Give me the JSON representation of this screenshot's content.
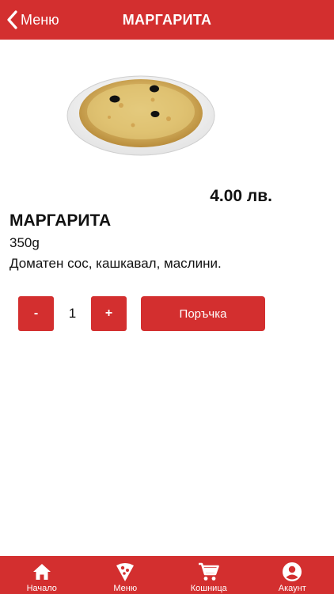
{
  "header": {
    "back_label": "Меню",
    "title": "МАРГАРИТА"
  },
  "product": {
    "price": "4.00 лв.",
    "name": "МАРГАРИТА",
    "weight": "350g",
    "description": "Доматен сос, кашкавал, маслини."
  },
  "order": {
    "minus_label": "-",
    "quantity": "1",
    "plus_label": "+",
    "order_label": "Поръчка"
  },
  "tabbar": {
    "items": [
      {
        "label": "Начало",
        "icon": "home-icon"
      },
      {
        "label": "Меню",
        "icon": "pizza-slice-icon"
      },
      {
        "label": "Кошница",
        "icon": "cart-icon"
      },
      {
        "label": "Акаунт",
        "icon": "account-icon"
      }
    ]
  },
  "colors": {
    "accent": "#d32f2f",
    "text": "#111111",
    "background": "#ffffff"
  }
}
